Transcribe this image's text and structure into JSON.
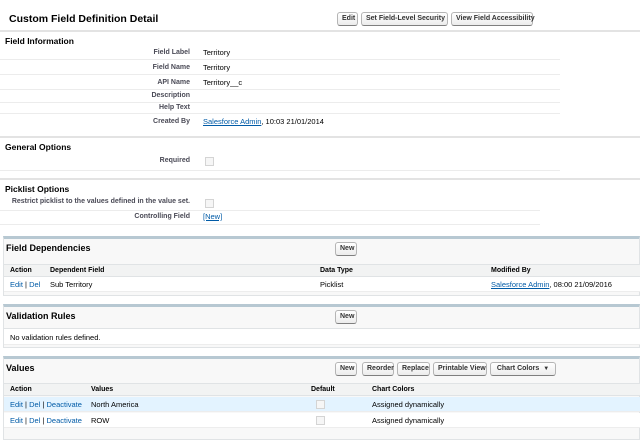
{
  "header": {
    "title": "Custom Field Definition Detail",
    "buttons": [
      "Edit",
      "Set Field-Level Security",
      "View Field Accessibility"
    ]
  },
  "field_info": {
    "heading": "Field Information",
    "rows": [
      {
        "label": "Field Label",
        "value": "Territory"
      },
      {
        "label": "Field Name",
        "value": "Territory"
      },
      {
        "label": "API Name",
        "value": "Territory__c"
      },
      {
        "label": "Description",
        "value": ""
      },
      {
        "label": "Help Text",
        "value": ""
      },
      {
        "label": "Created By",
        "link": "Salesforce Admin",
        "value": ", 10:03 21/01/2014"
      }
    ]
  },
  "general": {
    "heading": "General Options",
    "required_label": "Required"
  },
  "picklist": {
    "heading": "Picklist Options",
    "restrict_label": "Restrict picklist to the values defined in the value set.",
    "controlling_label": "Controlling Field",
    "controlling_value": "[New]"
  },
  "dependencies": {
    "title": "Field Dependencies",
    "new_button": "New",
    "columns": [
      "Action",
      "Dependent Field",
      "Data Type",
      "Modified By"
    ],
    "rows": [
      {
        "edit": "Edit",
        "sep": "|",
        "del": "Del",
        "field": "Sub Territory",
        "type": "Picklist",
        "modified_link": "Salesforce Admin",
        "modified_rest": ", 08:00 21/09/2016"
      }
    ]
  },
  "validation": {
    "title": "Validation Rules",
    "new_button": "New",
    "empty": "No validation rules defined."
  },
  "values": {
    "title": "Values",
    "buttons": [
      "New",
      "Reorder",
      "Replace",
      "Printable View",
      "Chart Colors"
    ],
    "chart_colors_caret": "▼",
    "columns": [
      "Action",
      "Values",
      "Default",
      "Chart Colors"
    ],
    "rows": [
      {
        "edit": "Edit",
        "del": "Del",
        "deact": "Deactivate",
        "sep": "|",
        "value": "North America",
        "chart": "Assigned dynamically"
      },
      {
        "edit": "Edit",
        "del": "Del",
        "deact": "Deactivate",
        "sep": "|",
        "value": "ROW",
        "chart": "Assigned dynamically"
      }
    ]
  },
  "colors": {
    "link": "#015ba7",
    "highlight_row": "#e3f3ff",
    "section_border": "#b7c8d2"
  }
}
